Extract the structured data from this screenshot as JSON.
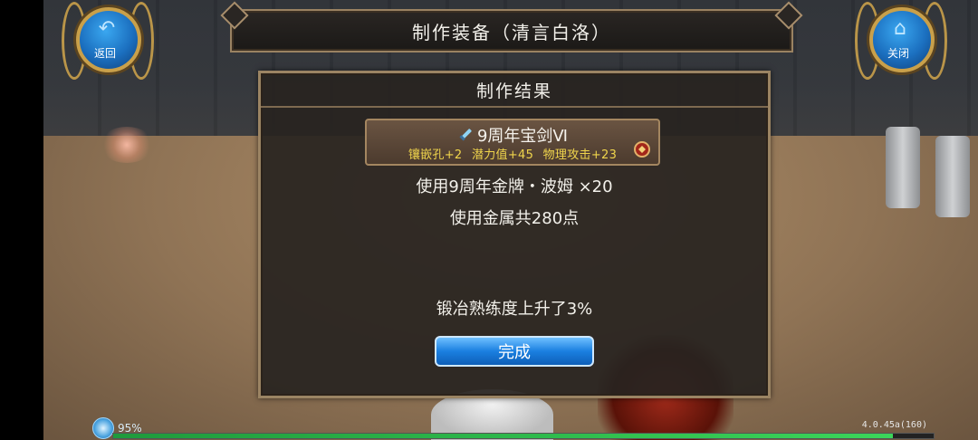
{
  "header": {
    "title": "制作装备（清言白洛）"
  },
  "back_button": {
    "label": "返回",
    "icon": "back-arrow-icon"
  },
  "close_button": {
    "label": "关闭",
    "icon": "home-icon"
  },
  "panel": {
    "title": "制作结果",
    "item": {
      "name": "9周年宝剑Ⅵ",
      "icon": "sword-icon",
      "stats": [
        "镶嵌孔+2",
        "潜力值+45",
        "物理攻击+23"
      ],
      "extra_icon": "gem-slot-icon"
    },
    "material_line": "使用9周年金牌・波姆 ×20",
    "metal_line": "使用金属共280点",
    "proficiency_line": "锻冶熟练度上升了3%",
    "done_label": "完成"
  },
  "status": {
    "battery_percent": "95%",
    "version": "4.0.45a(160)",
    "progress": 0.95
  },
  "colors": {
    "accent_blue": "#1a7fe0",
    "stat_yellow": "#f0d54c",
    "frame_gold": "#9b8463"
  }
}
